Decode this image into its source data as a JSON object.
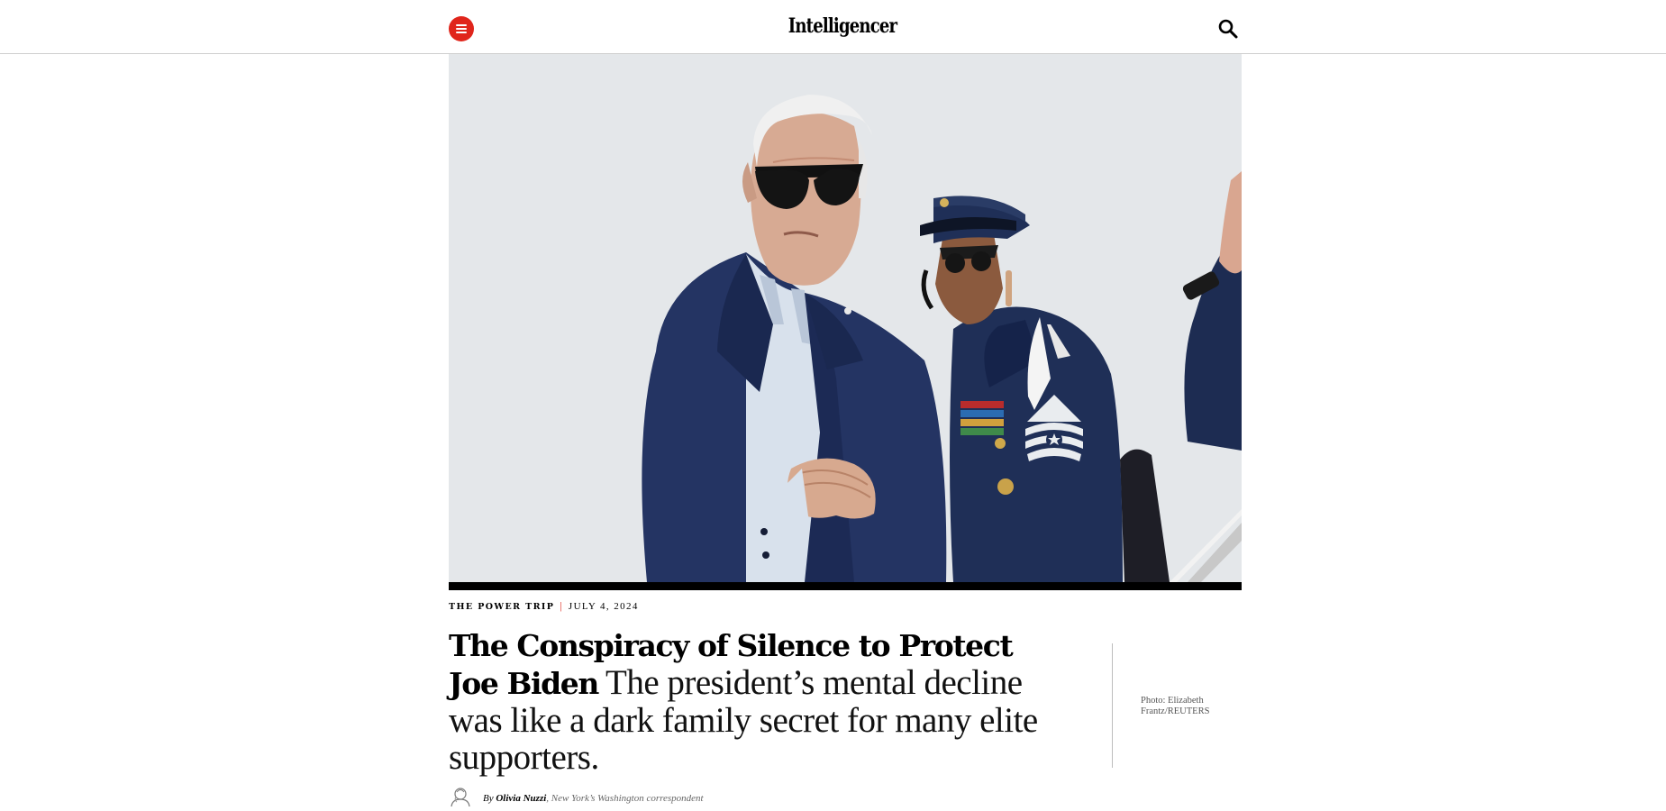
{
  "header": {
    "brand": "Intelligencer",
    "menu_icon": "hamburger-menu-icon",
    "search_icon": "search-icon"
  },
  "colors": {
    "accent": "#e0251b",
    "rule": "#cfcfcf",
    "text": "#000000",
    "muted": "#666666"
  },
  "article": {
    "rubric": "THE POWER TRIP",
    "separator": "|",
    "date": "JULY 4, 2024",
    "headline": "The Conspiracy of Silence to Protect Joe Biden",
    "dek": "The president’s mental decline was like a dark family secret for many elite supporters.",
    "photo_credit": "Photo: Elizabeth Frantz/REUTERS",
    "byline": {
      "by": "By",
      "author": "Olivia Nuzzi",
      "role": "New York’s Washington correspondent"
    }
  }
}
